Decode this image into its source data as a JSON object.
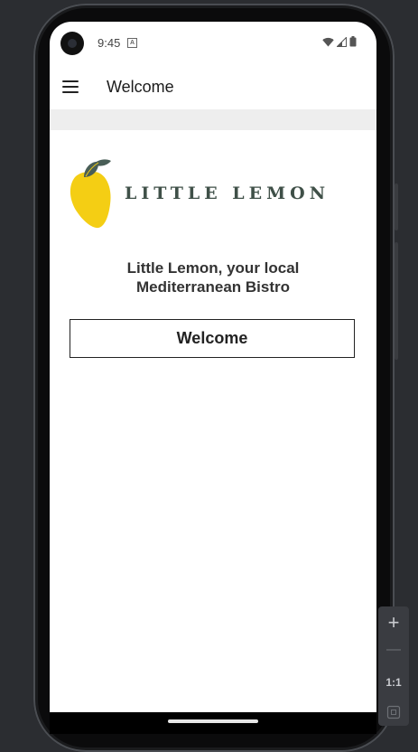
{
  "status_bar": {
    "time": "9:45",
    "notification_icon": "a-icon",
    "wifi_icon": "wifi-icon",
    "signal_icon": "signal-icon",
    "battery_icon": "battery-icon"
  },
  "app_bar": {
    "menu_icon": "hamburger-menu-icon",
    "title": "Welcome"
  },
  "logo": {
    "text": "LITTLE LEMON",
    "lemon_color": "#F4CE14",
    "leaf_color": "#495E57"
  },
  "main": {
    "tagline_line1": "Little Lemon, your local",
    "tagline_line2": "Mediterranean Bistro",
    "welcome_button_label": "Welcome"
  },
  "emulator_zoom": {
    "zoom_in": "+",
    "zoom_out": "—",
    "actual_size": "1:1",
    "fit_icon": "fit-screen-icon"
  },
  "colors": {
    "brand_green": "#495E57",
    "brand_yellow": "#F4CE14",
    "background": "#2B2D31"
  }
}
